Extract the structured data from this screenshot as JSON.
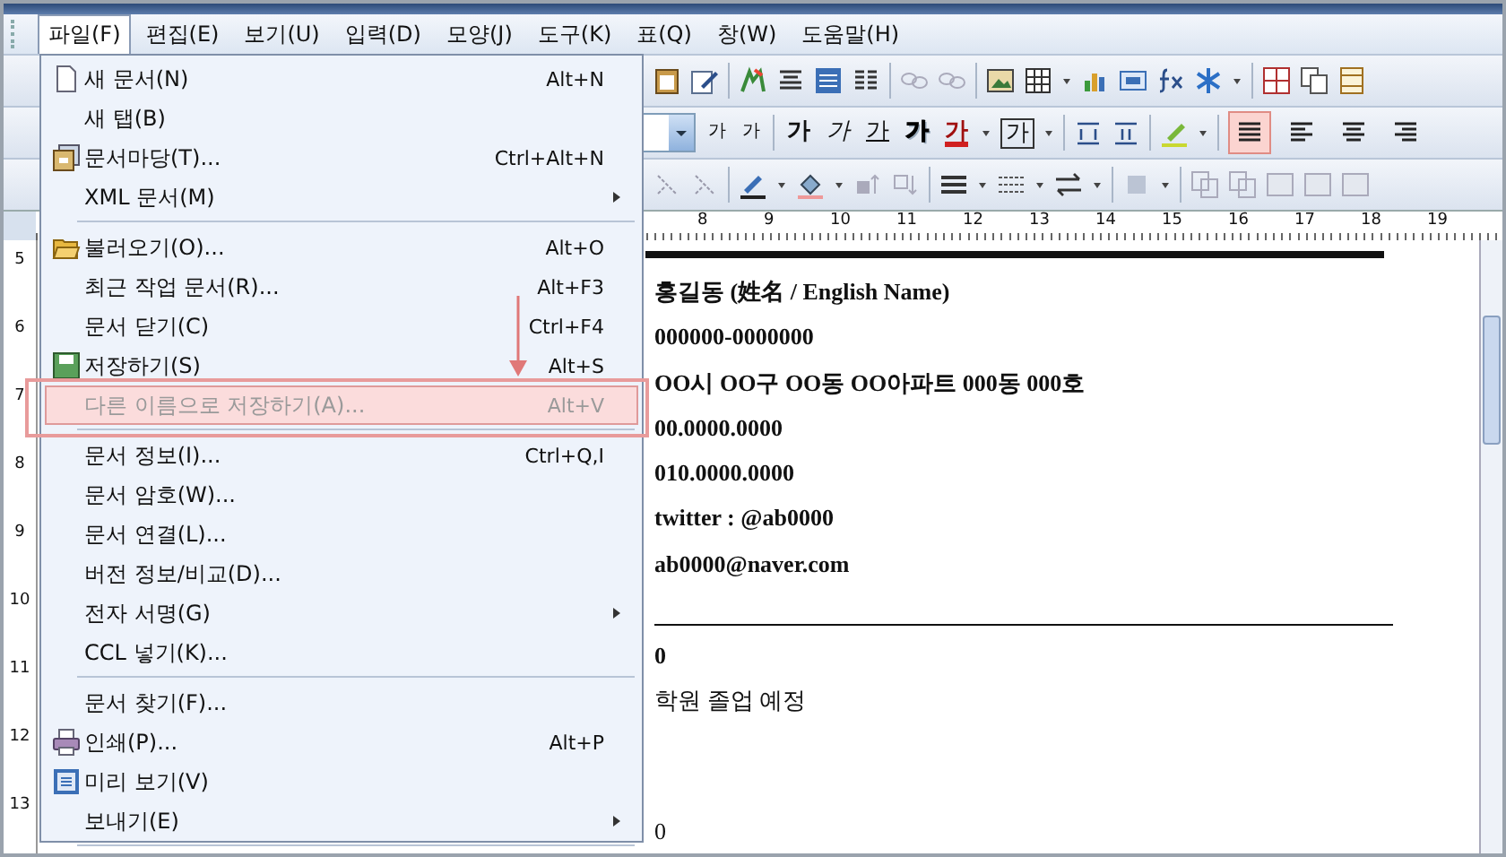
{
  "menubar": [
    {
      "label": "파일(F)",
      "selected": true
    },
    {
      "label": "편집(E)",
      "selected": false
    },
    {
      "label": "보기(U)",
      "selected": false
    },
    {
      "label": "입력(D)",
      "selected": false
    },
    {
      "label": "모양(J)",
      "selected": false
    },
    {
      "label": "도구(K)",
      "selected": false
    },
    {
      "label": "표(Q)",
      "selected": false
    },
    {
      "label": "창(W)",
      "selected": false
    },
    {
      "label": "도움말(H)",
      "selected": false
    }
  ],
  "format_toolbar": {
    "buttons": [
      {
        "label": "가",
        "kind": "grow"
      },
      {
        "label": "가",
        "kind": "shrink"
      },
      {
        "label": "가",
        "kind": "bold"
      },
      {
        "label": "가",
        "kind": "italic"
      },
      {
        "label": "가",
        "kind": "underline"
      },
      {
        "label": "가",
        "kind": "outline"
      },
      {
        "label": "가",
        "kind": "color"
      },
      {
        "label": "가",
        "kind": "boxed"
      }
    ],
    "align_buttons": [
      {
        "selected": true
      },
      {
        "selected": false
      },
      {
        "selected": false
      },
      {
        "selected": false
      }
    ]
  },
  "top_ruler": [
    "8",
    "9",
    "10",
    "11",
    "12",
    "13",
    "14",
    "15",
    "16",
    "17",
    "18",
    "19"
  ],
  "left_ruler": [
    "5",
    "6",
    "7",
    "8",
    "9",
    "10",
    "11",
    "12",
    "13"
  ],
  "document": {
    "lines": [
      {
        "text": "홍길동 (姓名 / English Name)",
        "bold": true
      },
      {
        "text": "000000-0000000",
        "bold": true
      },
      {
        "text": "OO시 OO구 OO동 OO아파트 000동 000호",
        "bold": true
      },
      {
        "text": "00.0000.0000",
        "bold": true
      },
      {
        "text": "010.0000.0000",
        "bold": true
      },
      {
        "text": "twitter : @ab0000",
        "bold": true
      },
      {
        "text": "ab0000@naver.com",
        "bold": true
      }
    ],
    "after_rule": [
      {
        "text": "0",
        "bold": true
      },
      {
        "text": "학원 졸업 예정",
        "bold": false
      }
    ],
    "bottom_line": "0"
  },
  "file_menu": {
    "items": [
      {
        "kind": "item",
        "label": "새 문서(N)",
        "shortcut": "Alt+N",
        "submenu": false,
        "highlighted": false
      },
      {
        "kind": "item",
        "label": "새 탭(B)",
        "submenu": false,
        "highlighted": false
      },
      {
        "kind": "item",
        "label": "문서마당(T)...",
        "shortcut": "Ctrl+Alt+N",
        "submenu": false,
        "highlighted": false
      },
      {
        "kind": "item",
        "label": "XML 문서(M)",
        "submenu": true,
        "highlighted": false
      },
      {
        "kind": "separator"
      },
      {
        "kind": "item",
        "label": "불러오기(O)...",
        "shortcut": "Alt+O",
        "submenu": false,
        "highlighted": false
      },
      {
        "kind": "item",
        "label": "최근 작업 문서(R)...",
        "shortcut": "Alt+F3",
        "submenu": false,
        "highlighted": false
      },
      {
        "kind": "item",
        "label": "문서 닫기(C)",
        "shortcut": "Ctrl+F4",
        "submenu": false,
        "highlighted": false
      },
      {
        "kind": "item",
        "label": "저장하기(S)",
        "shortcut": "Alt+S",
        "submenu": false,
        "highlighted": false
      },
      {
        "kind": "item",
        "label": "다른 이름으로 저장하기(A)...",
        "shortcut": "Alt+V",
        "submenu": false,
        "highlighted": true
      },
      {
        "kind": "separator"
      },
      {
        "kind": "item",
        "label": "문서 정보(I)...",
        "shortcut": "Ctrl+Q,I",
        "submenu": false,
        "highlighted": false
      },
      {
        "kind": "item",
        "label": "문서 암호(W)...",
        "submenu": false,
        "highlighted": false
      },
      {
        "kind": "item",
        "label": "문서 연결(L)...",
        "submenu": false,
        "highlighted": false
      },
      {
        "kind": "item",
        "label": "버전 정보/비교(D)...",
        "submenu": false,
        "highlighted": false
      },
      {
        "kind": "item",
        "label": "전자 서명(G)",
        "submenu": true,
        "highlighted": false
      },
      {
        "kind": "item",
        "label": "CCL 넣기(K)...",
        "submenu": false,
        "highlighted": false
      },
      {
        "kind": "separator"
      },
      {
        "kind": "item",
        "label": "문서 찾기(F)...",
        "submenu": false,
        "highlighted": false
      },
      {
        "kind": "item",
        "label": "인쇄(P)...",
        "shortcut": "Alt+P",
        "submenu": false,
        "highlighted": false
      },
      {
        "kind": "item",
        "label": "미리 보기(V)",
        "submenu": false,
        "highlighted": false
      },
      {
        "kind": "item",
        "label": "보내기(E)",
        "submenu": true,
        "highlighted": false
      },
      {
        "kind": "separator"
      }
    ]
  }
}
